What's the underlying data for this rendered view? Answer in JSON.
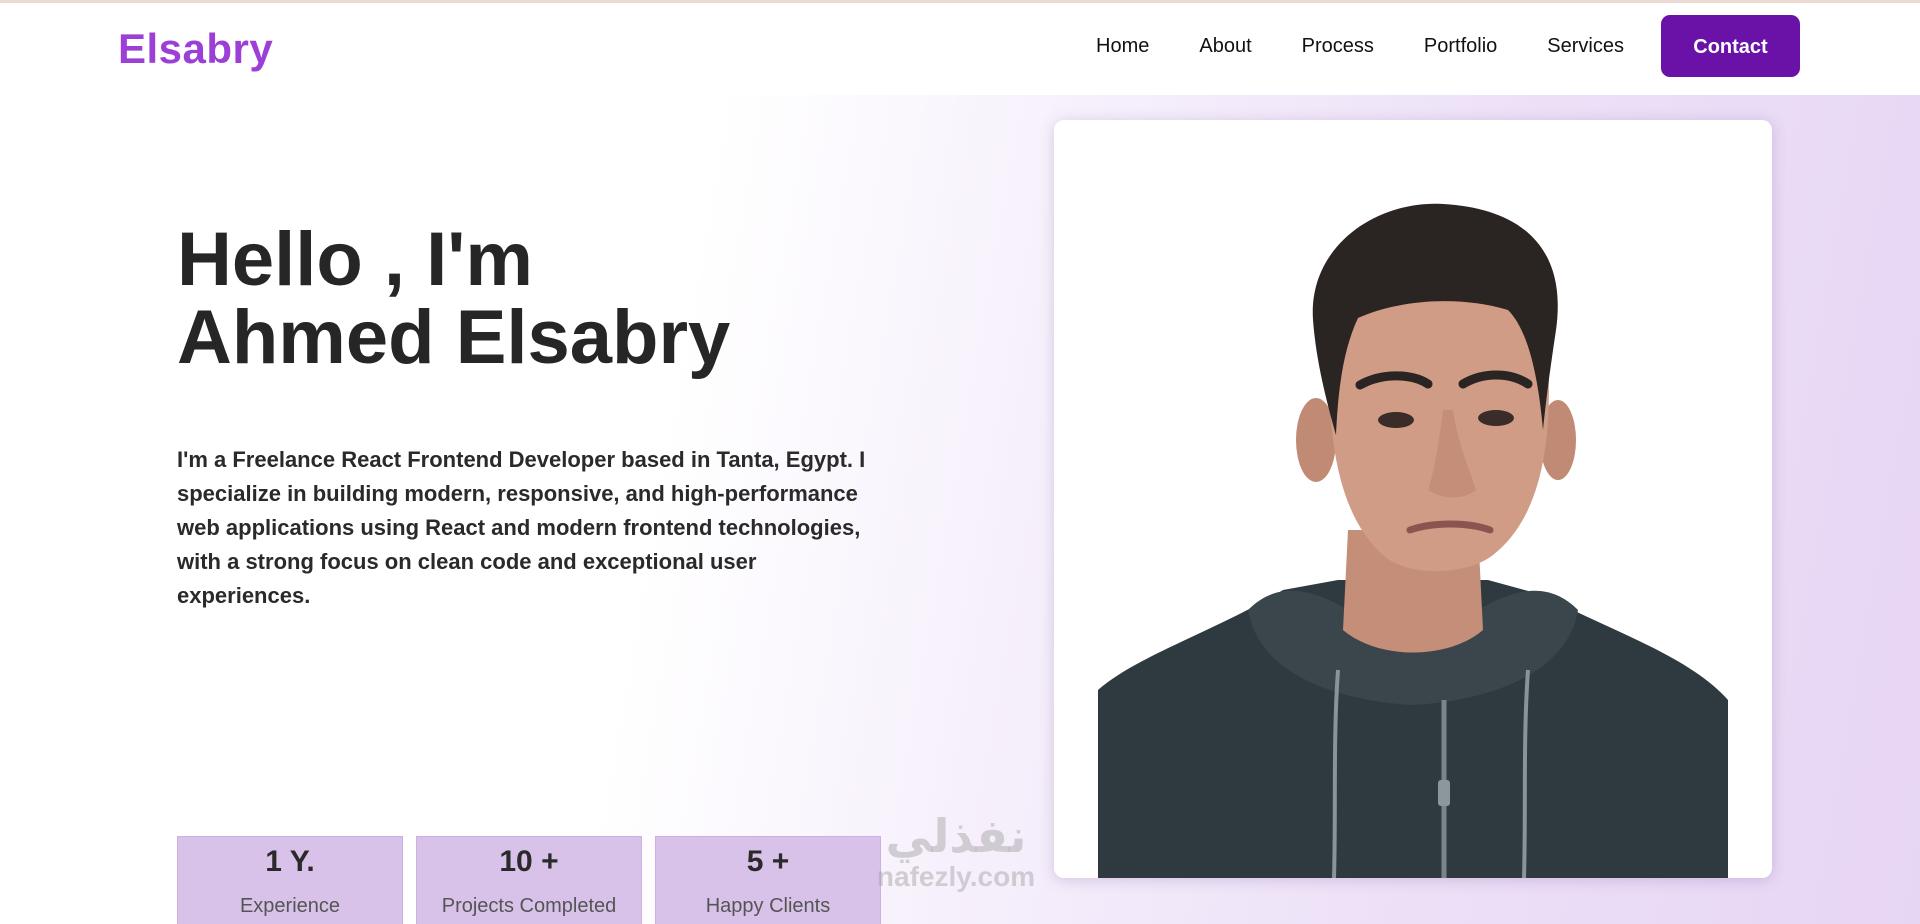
{
  "brand": {
    "name": "Elsabry",
    "color": "#9b3fd6"
  },
  "nav": {
    "items": [
      {
        "label": "Home"
      },
      {
        "label": "About"
      },
      {
        "label": "Process"
      },
      {
        "label": "Portfolio"
      },
      {
        "label": "Services"
      }
    ],
    "contact_label": "Contact",
    "contact_color": "#6a12a8"
  },
  "hero": {
    "title_line1": "Hello , I'm",
    "title_line2": "Ahmed Elsabry",
    "description": "I'm a Freelance React Frontend Developer based in Tanta, Egypt. I specialize in building modern, responsive, and high-performance web applications using React and modern frontend technologies, with a strong focus on clean code and exceptional user experiences."
  },
  "stats": [
    {
      "value": "1 Y.",
      "label": "Experience"
    },
    {
      "value": "10 +",
      "label": "Projects Completed"
    },
    {
      "value": "5 +",
      "label": "Happy Clients"
    }
  ],
  "watermark": {
    "line1": "نفذلي",
    "line2": "nafezly.com"
  }
}
